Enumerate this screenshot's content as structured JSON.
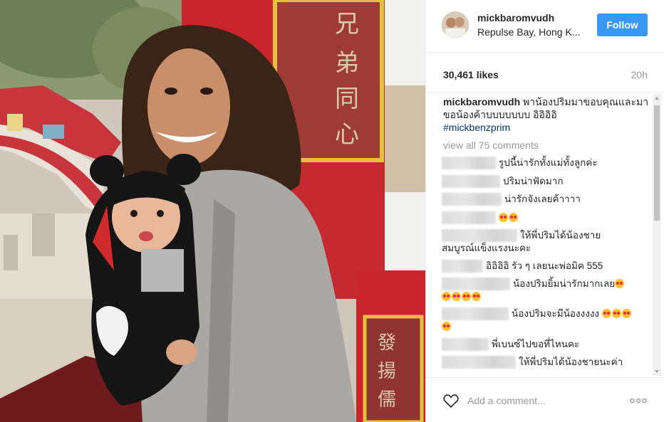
{
  "post": {
    "username": "mickbaromvudh",
    "location": "Repulse Bay, Hong K...",
    "follow_label": "Follow",
    "likes": "30,461 likes",
    "time": "20h",
    "caption_user": "mickbaromvudh",
    "caption_text": "พาน้องปริมมาขอบคุณและมาขอน้องค้าบบบบบบบ อิอิอิอิ",
    "hashtag": "#mickbenzprim",
    "view_all": "view all 75 comments"
  },
  "comments": [
    {
      "text": "รูปนี้น่ารักทั้งแม่ทั้งลูกค่ะ"
    },
    {
      "text": "ปริมน่าฟัดมาก"
    },
    {
      "text": "น่ารักจังเลยค้าาาา"
    },
    {
      "text": ""
    },
    {
      "text": "ให้พี่ปริมได้น้องชาย",
      "line2": "สมบูรณ์แข็งแรงนะคะ"
    },
    {
      "text": "อิอิอิอิ รัว ๆ เลยนะพ่อมิค 555"
    },
    {
      "text": "น้องปริมยิ้มน่ารักมากเลย"
    },
    {
      "text": "น้องปริมจะมีน้องงงงง"
    },
    {
      "text": "พี่เบนซ์ไปขอที่ไหนคะ"
    },
    {
      "text": "ให้พี่ปริมได้น้องชายนะค่า"
    }
  ],
  "footer": {
    "comment_placeholder": "Add a comment...",
    "heart_icon": "heart-outline-icon",
    "more_icon": "more-horizontal-icon"
  },
  "colors": {
    "follow_button": "#3897f0",
    "hashtag": "#003569",
    "muted": "#999999",
    "text": "#262626",
    "divider": "#efefef"
  }
}
